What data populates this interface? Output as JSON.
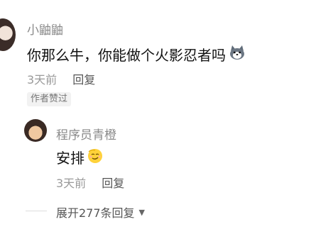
{
  "comment": {
    "author": "小鼬鼬",
    "text": "你那么牛，你能做个火影忍者吗",
    "emoji": "husky-emoji-icon",
    "time": "3天前",
    "reply_label": "回复",
    "badge": "作者赞过"
  },
  "reply": {
    "author": "程序员青橙",
    "text": "安排",
    "emoji": "smirk-emoji-icon",
    "time": "3天前",
    "reply_label": "回复"
  },
  "expand": {
    "label": "展开277条回复",
    "icon": "chevron-down-icon"
  }
}
